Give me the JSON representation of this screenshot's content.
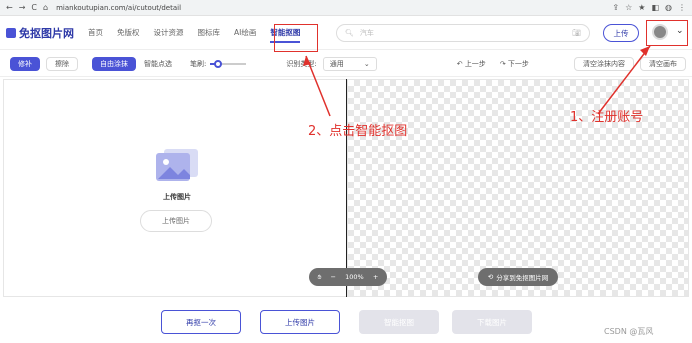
{
  "browser": {
    "url": "miankoutupian.com/ai/cutout/detail",
    "nav": [
      "←",
      "→",
      "C",
      "⌂"
    ],
    "right_icons": [
      "⇪",
      "☆",
      "★",
      "◧",
      "◍",
      "⋮"
    ]
  },
  "header": {
    "logo_text": "免抠图片网",
    "menu": [
      "首页",
      "免版权",
      "设计资源",
      "图标库",
      "AI绘画",
      "智能抠图"
    ],
    "search_placeholder": "汽车",
    "upload_label": "上传"
  },
  "toolbar": {
    "buttons": [
      "修补",
      "擦除",
      "自由涂抹",
      "智能点选"
    ],
    "brush_label": "笔刷:",
    "brush_level": 0.2,
    "recog_label": "识别类型:",
    "recog_value": "通用",
    "undo": "上一步",
    "redo": "下一步",
    "clear_left": "清空涂抹内容",
    "clear_right": "清空画布"
  },
  "canvas": {
    "upload_title": "上传图片",
    "upload_button": "上传图片",
    "zoom": "100%",
    "share": "分享到免抠图片网"
  },
  "bottom": {
    "rebtn": "再抠一次",
    "upload": "上传图片",
    "smart": "智能抠图",
    "download": "下载图片"
  },
  "annotations": {
    "step1": "1、注册账号",
    "step2": "2、点击智能抠图"
  },
  "watermark": "CSDN @瓦风",
  "colors": {
    "accent": "#4a53d6",
    "annotation": "#e0312c"
  }
}
